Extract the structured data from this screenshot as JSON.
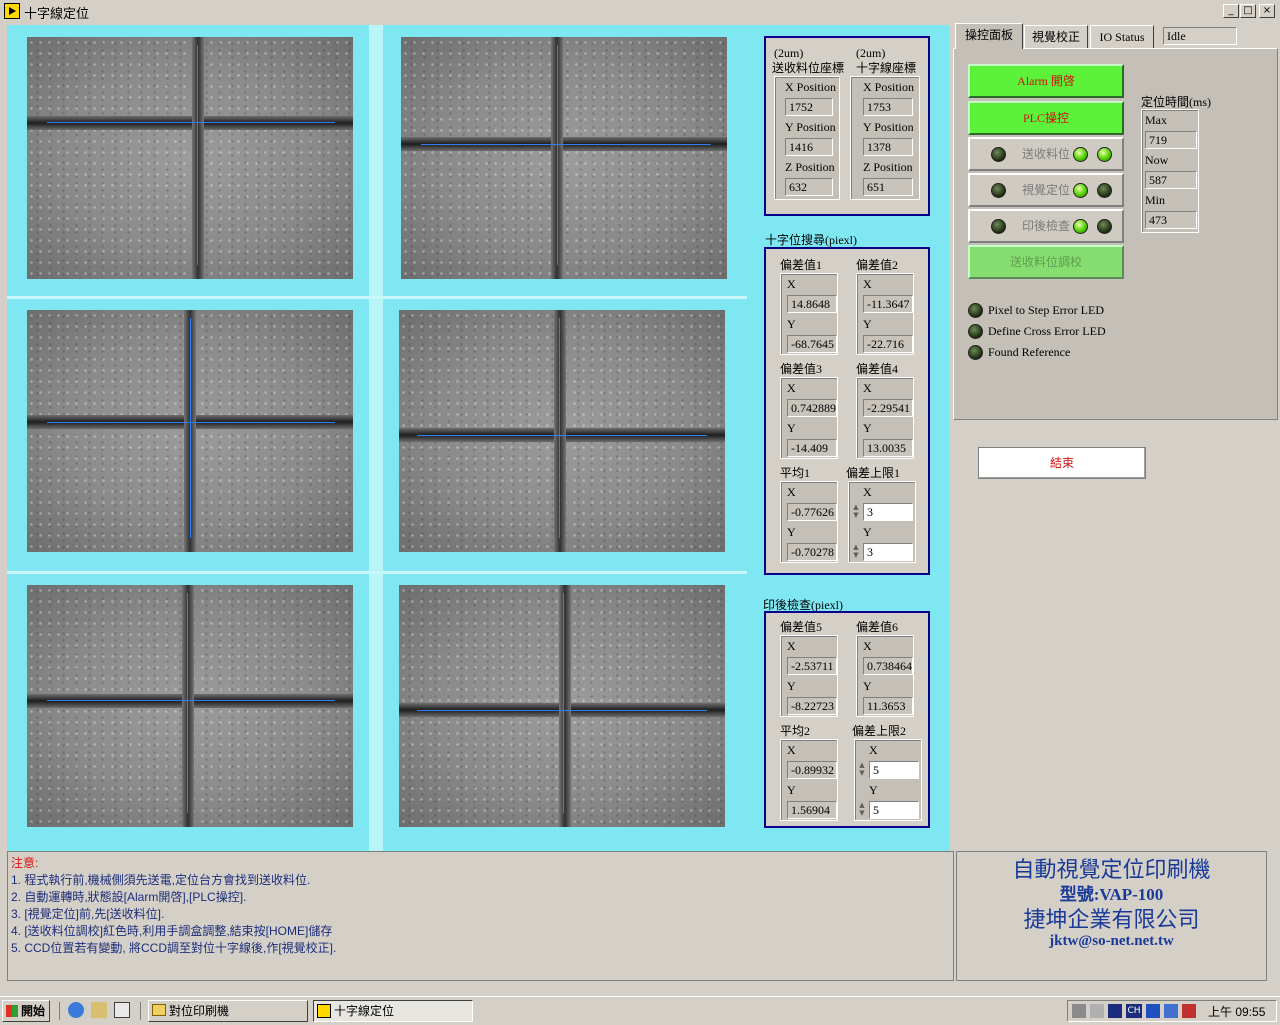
{
  "window": {
    "title": "十字線定位",
    "min": "_",
    "max": "□",
    "close": "×"
  },
  "tabs": [
    "操控面板",
    "視覺校正",
    "IO Status"
  ],
  "status": "Idle",
  "coords": {
    "feed_header": [
      "(2um)",
      "送收料位座標"
    ],
    "cross_header": [
      "(2um)",
      "十字線座標"
    ],
    "x_label": "X Position",
    "y_label": "Y Position",
    "z_label": "Z Position",
    "feed": {
      "x": "1752",
      "y": "1416",
      "z": "632"
    },
    "cross": {
      "x": "1753",
      "y": "1378",
      "z": "651"
    }
  },
  "search": {
    "title": "十字位搜尋(piexl)",
    "groups": [
      {
        "label": "偏差值1",
        "x": "14.8648",
        "y": "-68.7645"
      },
      {
        "label": "偏差值2",
        "x": "-11.3647",
        "y": "-22.716"
      },
      {
        "label": "偏差值3",
        "x": "0.742889",
        "y": "-14.409"
      },
      {
        "label": "偏差值4",
        "x": "-2.29541",
        "y": "13.0035"
      },
      {
        "label": "平均1",
        "x": "-0.77626",
        "y": "-0.70278"
      },
      {
        "label": "偏差上限1",
        "x": "3",
        "y": "3"
      }
    ]
  },
  "postcheck": {
    "title": "印後檢查(piexl)",
    "groups": [
      {
        "label": "偏差值5",
        "x": "-2.53711",
        "y": "-8.22723"
      },
      {
        "label": "偏差值6",
        "x": "0.738464",
        "y": "11.3653"
      },
      {
        "label": "平均2",
        "x": "-0.89932",
        "y": "1.56904"
      },
      {
        "label": "偏差上限2",
        "x": "5",
        "y": "5"
      }
    ]
  },
  "xy": {
    "x": "X",
    "y": "Y"
  },
  "controls": {
    "alarm": "Alarm 開啓",
    "plc": "PLC操控",
    "feed_pos": "送收料位",
    "vision_pos": "視覺定位",
    "post_check": "印後檢查",
    "feed_calib": "送收料位調校"
  },
  "timing": {
    "title": "定位時間(ms)",
    "max_label": "Max",
    "max": "719",
    "now_label": "Now",
    "now": "587",
    "min_label": "Min",
    "min": "473"
  },
  "leds": [
    "Pixel to Step Error LED",
    "Define Cross  Error LED",
    "Found Reference"
  ],
  "end_button": "結束",
  "notes": [
    "注意:",
    "1. 程式執行前,機械側須先送電,定位台方會找到送收料位.",
    "2. 自動運轉時,狀態設[Alarm開啓],[PLC操控].",
    "3. [視覺定位]前,先[送收料位].",
    "4. [送收料位調校]紅色時,利用手調盒調整,結束按[HOME]儲存",
    "5. CCD位置若有變動, 將CCD調至對位十字線後,作[視覺校正]."
  ],
  "brand": {
    "name": "自動視覺定位印刷機",
    "model": "型號:VAP-100",
    "company": "捷坤企業有限公司",
    "email": "jktw@so-net.net.tw"
  },
  "taskbar": {
    "start": "開始",
    "task1": "對位印刷機",
    "task2": "十字線定位",
    "clock": "上午 09:55"
  }
}
